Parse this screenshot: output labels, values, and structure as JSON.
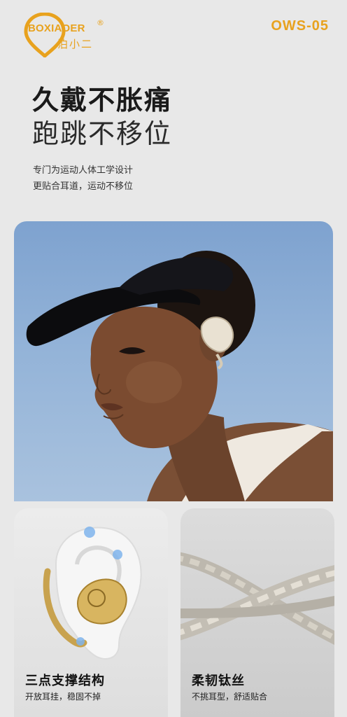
{
  "brand": {
    "name_en": "BOXIAOER",
    "registered_mark": "®",
    "name_cn": "泊小二",
    "model": "OWS-05"
  },
  "headline": {
    "line1": "久戴不胀痛",
    "line2": "跑跳不移位",
    "sub1": "专门为运动人体工学设计",
    "sub2": "更贴合耳道，运动不移位"
  },
  "features": [
    {
      "title": "三点支撑结构",
      "sub": "开放耳挂，稳固不掉"
    },
    {
      "title": "柔韧钛丝",
      "sub": "不挑耳型，舒适贴合"
    }
  ],
  "colors": {
    "accent": "#e8a21e",
    "sky": "#8fb0d6",
    "background": "#e8e8e8"
  }
}
